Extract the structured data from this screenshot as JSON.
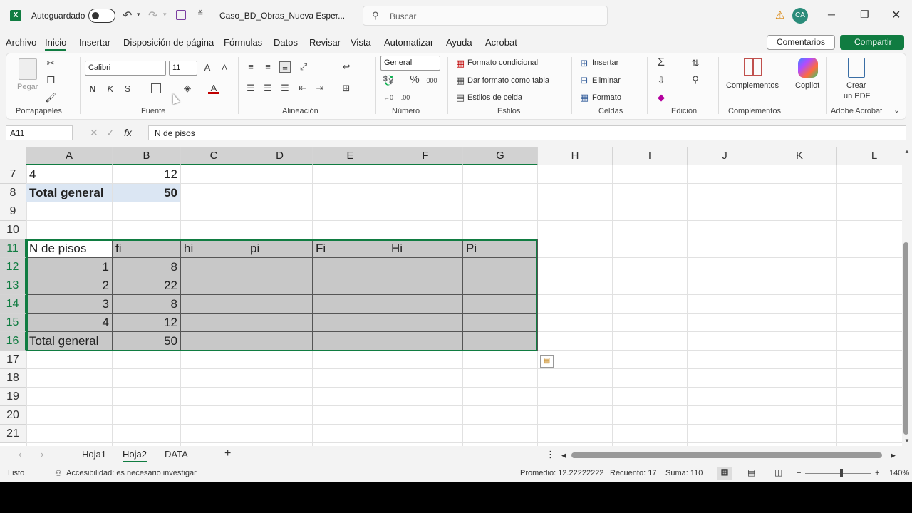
{
  "titlebar": {
    "autosave": "Autoguardado",
    "filename": "Caso_BD_Obras_Nueva Esper...",
    "search_placeholder": "Buscar",
    "avatar": "CA"
  },
  "menu": [
    "Archivo",
    "Inicio",
    "Insertar",
    "Disposición de página",
    "Fórmulas",
    "Datos",
    "Revisar",
    "Vista",
    "Automatizar",
    "Ayuda",
    "Acrobat"
  ],
  "buttons": {
    "comments": "Comentarios",
    "share": "Compartir"
  },
  "ribbon": {
    "paste": "Pegar",
    "font_name": "Calibri",
    "font_size": "11",
    "bold": "N",
    "italic": "K",
    "underline": "S",
    "number_format": "General",
    "cond_format": "Formato condicional",
    "table_format": "Dar formato como tabla",
    "cell_styles": "Estilos de celda",
    "insert": "Insertar",
    "delete": "Eliminar",
    "format": "Formato",
    "addins": "Complementos",
    "copilot": "Copilot",
    "create_pdf_1": "Crear",
    "create_pdf_2": "un PDF",
    "groups": {
      "clipboard": "Portapapeles",
      "font": "Fuente",
      "alignment": "Alineación",
      "number": "Número",
      "styles": "Estilos",
      "cells": "Celdas",
      "editing": "Edición",
      "addins": "Complementos",
      "acrobat": "Adobe Acrobat"
    }
  },
  "formula_bar": {
    "name_box": "A11",
    "formula": "N de pisos"
  },
  "columns": [
    "A",
    "B",
    "C",
    "D",
    "E",
    "F",
    "G",
    "H",
    "I",
    "J",
    "K",
    "L"
  ],
  "rows": [
    "7",
    "8",
    "9",
    "10",
    "11",
    "12",
    "13",
    "14",
    "15",
    "16",
    "17",
    "18",
    "19",
    "20",
    "21"
  ],
  "cells": {
    "a7": "4",
    "b7": "12",
    "a8": "Total general",
    "b8": "50",
    "a11": "N de pisos",
    "b11": "fi",
    "c11": "hi",
    "d11": "pi",
    "e11": "Fi",
    "f11": "Hi",
    "g11": "Pi",
    "a12": "1",
    "b12": "8",
    "a13": "2",
    "b13": "22",
    "a14": "3",
    "b14": "8",
    "a15": "4",
    "b15": "12",
    "a16": "Total general",
    "b16": "50"
  },
  "sheets": [
    "Hoja1",
    "Hoja2",
    "DATA"
  ],
  "active_sheet": "Hoja2",
  "status": {
    "ready": "Listo",
    "accessibility": "Accesibilidad: es necesario investigar",
    "average": "Promedio: 12.22222222",
    "count": "Recuento: 17",
    "sum": "Suma: 110",
    "zoom": "140%"
  },
  "colors": {
    "accent": "#107c41",
    "selection": "#c8c8c8",
    "pivot": "#dbe6f3"
  }
}
